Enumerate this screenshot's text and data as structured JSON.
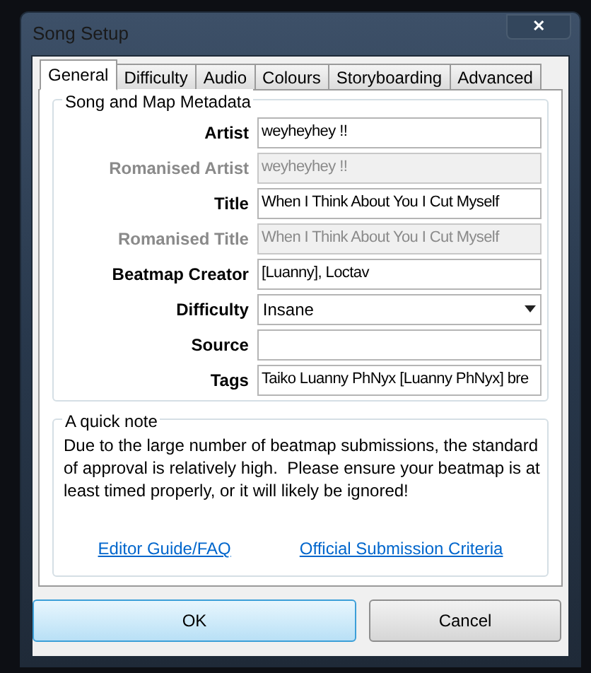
{
  "window": {
    "title": "Song Setup",
    "close": "✕"
  },
  "tabs": [
    {
      "label": "General",
      "selected": true
    },
    {
      "label": "Difficulty",
      "selected": false
    },
    {
      "label": "Audio",
      "selected": false
    },
    {
      "label": "Colours",
      "selected": false
    },
    {
      "label": "Storyboarding",
      "selected": false
    },
    {
      "label": "Advanced",
      "selected": false
    }
  ],
  "metadata": {
    "title": "Song and Map Metadata",
    "fields": [
      {
        "kind": "text",
        "label": "Artist",
        "value": "weyheyhey !!",
        "disabled": false
      },
      {
        "kind": "text",
        "label": "Romanised Artist",
        "value": "weyheyhey !!",
        "disabled": true
      },
      {
        "kind": "text",
        "label": "Title",
        "value": "When I Think About You I Cut Myself",
        "disabled": false
      },
      {
        "kind": "text",
        "label": "Romanised Title",
        "value": "When I Think About You I Cut Myself",
        "disabled": true
      },
      {
        "kind": "text",
        "label": "Beatmap Creator",
        "value": "[Luanny], Loctav",
        "disabled": false
      },
      {
        "kind": "dropdown",
        "label": "Difficulty",
        "value": "Insane",
        "disabled": false
      },
      {
        "kind": "text",
        "label": "Source",
        "disabled": false
      },
      {
        "kind": "text",
        "label": "Tags",
        "value": "Taiko Luanny PhNyx [Luanny PhNyx] bre",
        "disabled": false
      }
    ]
  },
  "note": {
    "title": "A quick note",
    "text": "Due to the large number of beatmap submissions, the standard of approval is relatively high.  Please ensure your beatmap is at least timed properly, or it will likely be ignored!",
    "links": [
      "Editor Guide/FAQ",
      "Official Submission Criteria"
    ]
  },
  "buttons": [
    {
      "label": "OK",
      "selected": true
    },
    {
      "label": "Cancel",
      "selected": false
    }
  ]
}
